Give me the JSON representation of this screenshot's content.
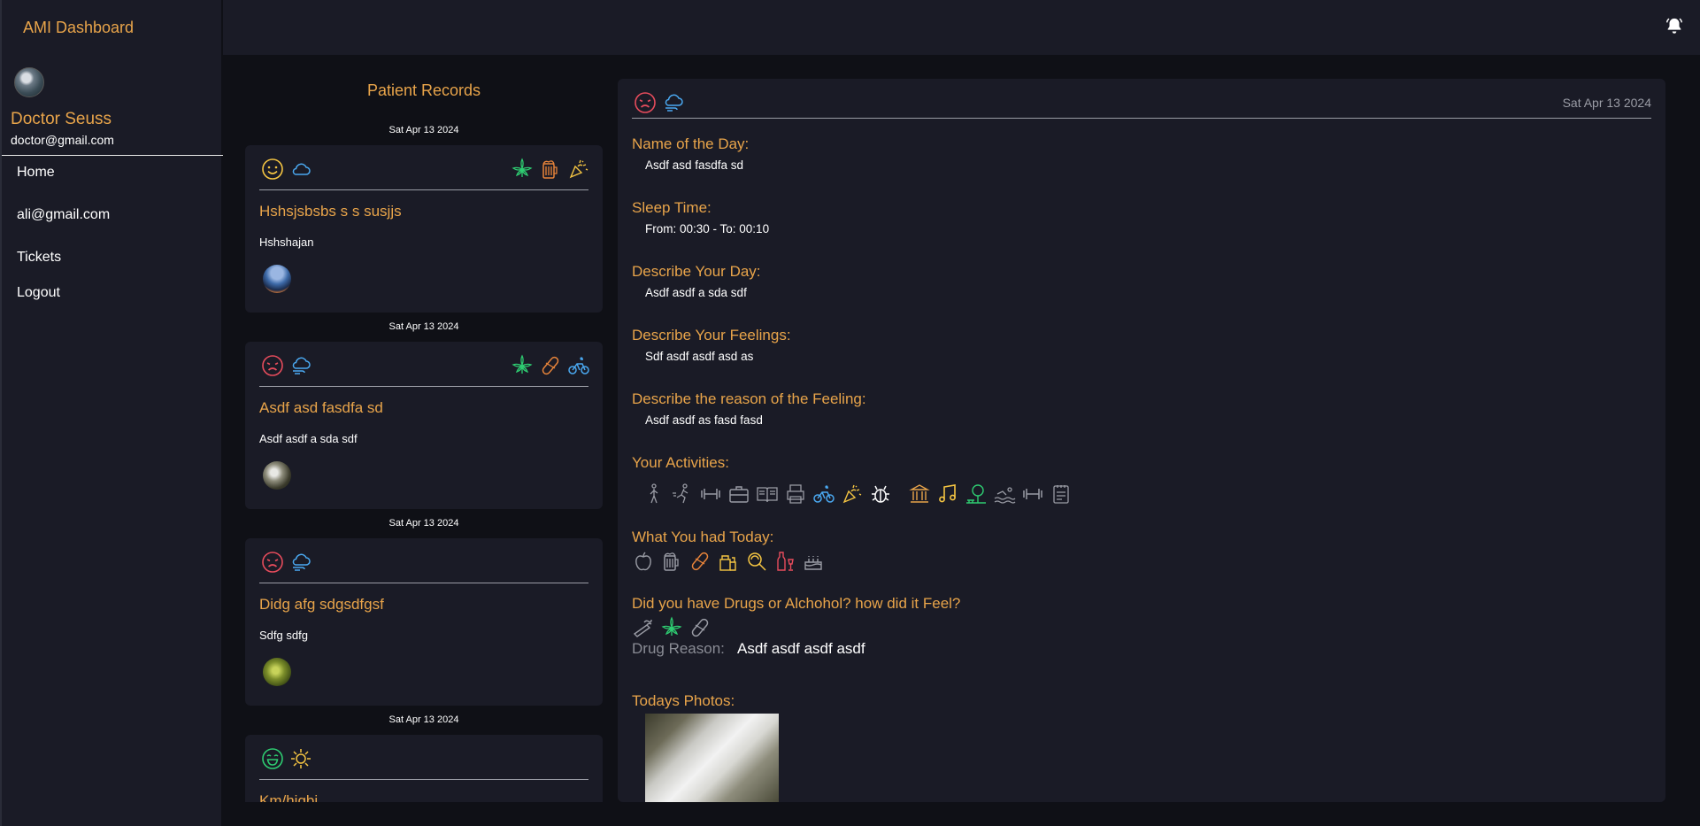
{
  "app": {
    "brand": "AMI Dashboard"
  },
  "user": {
    "name": "Doctor Seuss",
    "email": "doctor@gmail.com"
  },
  "nav": {
    "items": [
      {
        "label": "Home"
      },
      {
        "label": "ali@gmail.com"
      },
      {
        "label": "Tickets"
      },
      {
        "label": "Logout"
      }
    ]
  },
  "records": {
    "title": "Patient Records",
    "items": [
      {
        "date": "Sat Apr 13 2024",
        "title": "Hshsjsbsbs s s susjjs",
        "text": "Hshshajan",
        "mood": "smile",
        "weather": "cloud",
        "tags": [
          "cannabis",
          "beer",
          "party"
        ]
      },
      {
        "date": "Sat Apr 13 2024",
        "title": "Asdf asd fasdfa sd",
        "text": "Asdf asdf a sda sdf",
        "mood": "sad",
        "weather": "windy-cloud",
        "tags": [
          "cannabis",
          "pill",
          "bike"
        ]
      },
      {
        "date": "Sat Apr 13 2024",
        "title": "Didg afg sdgsdfgsf",
        "text": "Sdfg sdfg",
        "mood": "sad",
        "weather": "windy-cloud",
        "tags": []
      },
      {
        "date": "Sat Apr 13 2024",
        "title": "Km/higbi",
        "text": "",
        "mood": "laugh",
        "weather": "sun",
        "tags": []
      }
    ]
  },
  "detail": {
    "date": "Sat Apr 13 2024",
    "mood": "sad",
    "weather": "windy-cloud",
    "name_label": "Name of the Day:",
    "name_value": "Asdf asd fasdfa sd",
    "sleep_label": "Sleep Time:",
    "sleep_value": "From: 00:30 - To: 00:10",
    "day_label": "Describe Your Day:",
    "day_value": "Asdf asdf a sda sdf",
    "feel_label": "Describe Your Feelings:",
    "feel_value": "Sdf asdf asdf asd as",
    "reason_label": "Describe the reason of the Feeling:",
    "reason_value": "Asdf asdf as fasd fasd",
    "activities_label": "Your Activities:",
    "activities": [
      "walk",
      "run",
      "gym",
      "work",
      "read",
      "print",
      "bike",
      "party",
      "bug",
      "building",
      "music",
      "park",
      "swim",
      "gym",
      "notes"
    ],
    "food_label": "What You had Today:",
    "food": [
      "apple",
      "beer",
      "pill",
      "food",
      "lollipop",
      "wine",
      "cake"
    ],
    "drugs_label": "Did you have Drugs or Alchohol? how did it Feel?",
    "drugs": [
      "smoke",
      "cannabis",
      "pill"
    ],
    "drug_reason_label": "Drug Reason:",
    "drug_reason_value": "Asdf asdf asdf asdf",
    "photos_label": "Todays Photos:"
  },
  "colors": {
    "accent": "#e8a44a",
    "panel": "#1a1b26",
    "background": "#0f1016",
    "green": "#2ecc71",
    "red": "#e74c5c",
    "blue": "#4aa8f0",
    "yellow": "#f5c542",
    "orange": "#e8843a",
    "gray": "#9a9ca5"
  }
}
